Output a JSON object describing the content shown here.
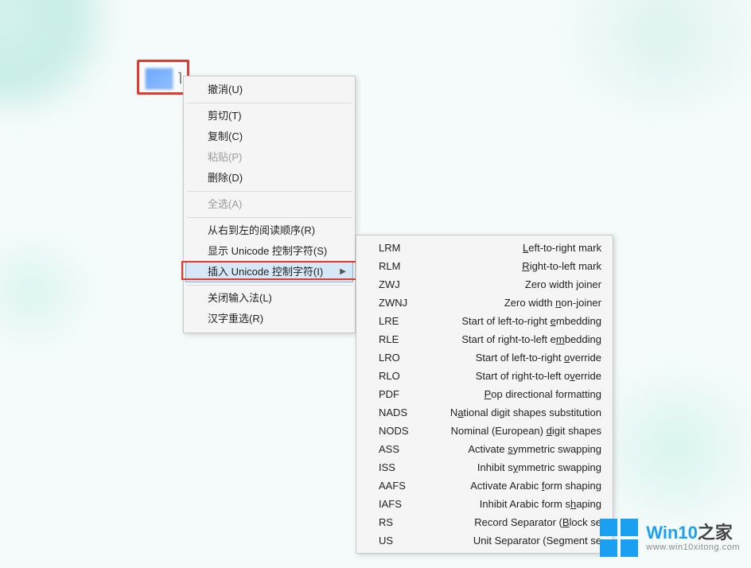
{
  "desktop_icon": {
    "caret": "⌉"
  },
  "menu": {
    "items": [
      {
        "label": "撤消(U)",
        "disabled": false
      },
      {
        "sep": true
      },
      {
        "label": "剪切(T)",
        "disabled": false
      },
      {
        "label": "复制(C)",
        "disabled": false
      },
      {
        "label": "粘贴(P)",
        "disabled": true
      },
      {
        "label": "删除(D)",
        "disabled": false
      },
      {
        "sep": true
      },
      {
        "label": "全选(A)",
        "disabled": true
      },
      {
        "sep": true
      },
      {
        "label": "从右到左的阅读顺序(R)",
        "disabled": false
      },
      {
        "label": "显示 Unicode 控制字符(S)",
        "disabled": false
      },
      {
        "label": "插入 Unicode 控制字符(I)",
        "disabled": false,
        "highlight": true,
        "submenu": true
      },
      {
        "sep": true
      },
      {
        "label": "关闭输入法(L)",
        "disabled": false
      },
      {
        "label": "汉字重选(R)",
        "disabled": false
      }
    ]
  },
  "submenu": {
    "rows": [
      {
        "abbr": "LRM",
        "desc_pre": "",
        "u": "L",
        "desc_post": "eft-to-right mark"
      },
      {
        "abbr": "RLM",
        "desc_pre": "",
        "u": "R",
        "desc_post": "ight-to-left mark"
      },
      {
        "abbr": "ZWJ",
        "desc_pre": "Zero width ",
        "u": "j",
        "desc_post": "oiner"
      },
      {
        "abbr": "ZWNJ",
        "desc_pre": "Zero width ",
        "u": "n",
        "desc_post": "on-joiner"
      },
      {
        "abbr": "LRE",
        "desc_pre": "Start of left-to-right ",
        "u": "e",
        "desc_post": "mbedding"
      },
      {
        "abbr": "RLE",
        "desc_pre": "Start of right-to-left e",
        "u": "m",
        "desc_post": "bedding"
      },
      {
        "abbr": "LRO",
        "desc_pre": "Start of left-to-right ",
        "u": "o",
        "desc_post": "verride"
      },
      {
        "abbr": "RLO",
        "desc_pre": "Start of right-to-left o",
        "u": "v",
        "desc_post": "erride"
      },
      {
        "abbr": "PDF",
        "desc_pre": "",
        "u": "P",
        "desc_post": "op directional formatting"
      },
      {
        "abbr": "NADS",
        "desc_pre": "N",
        "u": "a",
        "desc_post": "tional digit shapes substitution"
      },
      {
        "abbr": "NODS",
        "desc_pre": "Nominal (European) ",
        "u": "d",
        "desc_post": "igit shapes"
      },
      {
        "abbr": "ASS",
        "desc_pre": "Activate ",
        "u": "s",
        "desc_post": "ymmetric swapping"
      },
      {
        "abbr": "ISS",
        "desc_pre": "Inhibit s",
        "u": "y",
        "desc_post": "mmetric swapping"
      },
      {
        "abbr": "AAFS",
        "desc_pre": "Activate Arabic ",
        "u": "f",
        "desc_post": "orm shaping"
      },
      {
        "abbr": "IAFS",
        "desc_pre": "Inhibit Arabic form s",
        "u": "h",
        "desc_post": "aping"
      },
      {
        "abbr": "RS",
        "desc_pre": "Record Separator (",
        "u": "B",
        "desc_post": "lock se"
      },
      {
        "abbr": "US",
        "desc_pre": "Unit Separator (Se",
        "u": "g",
        "desc_post": "ment se"
      }
    ]
  },
  "brand": {
    "title_main": "Win10",
    "title_tail": "之家",
    "url": "www.win10xitong.com"
  }
}
